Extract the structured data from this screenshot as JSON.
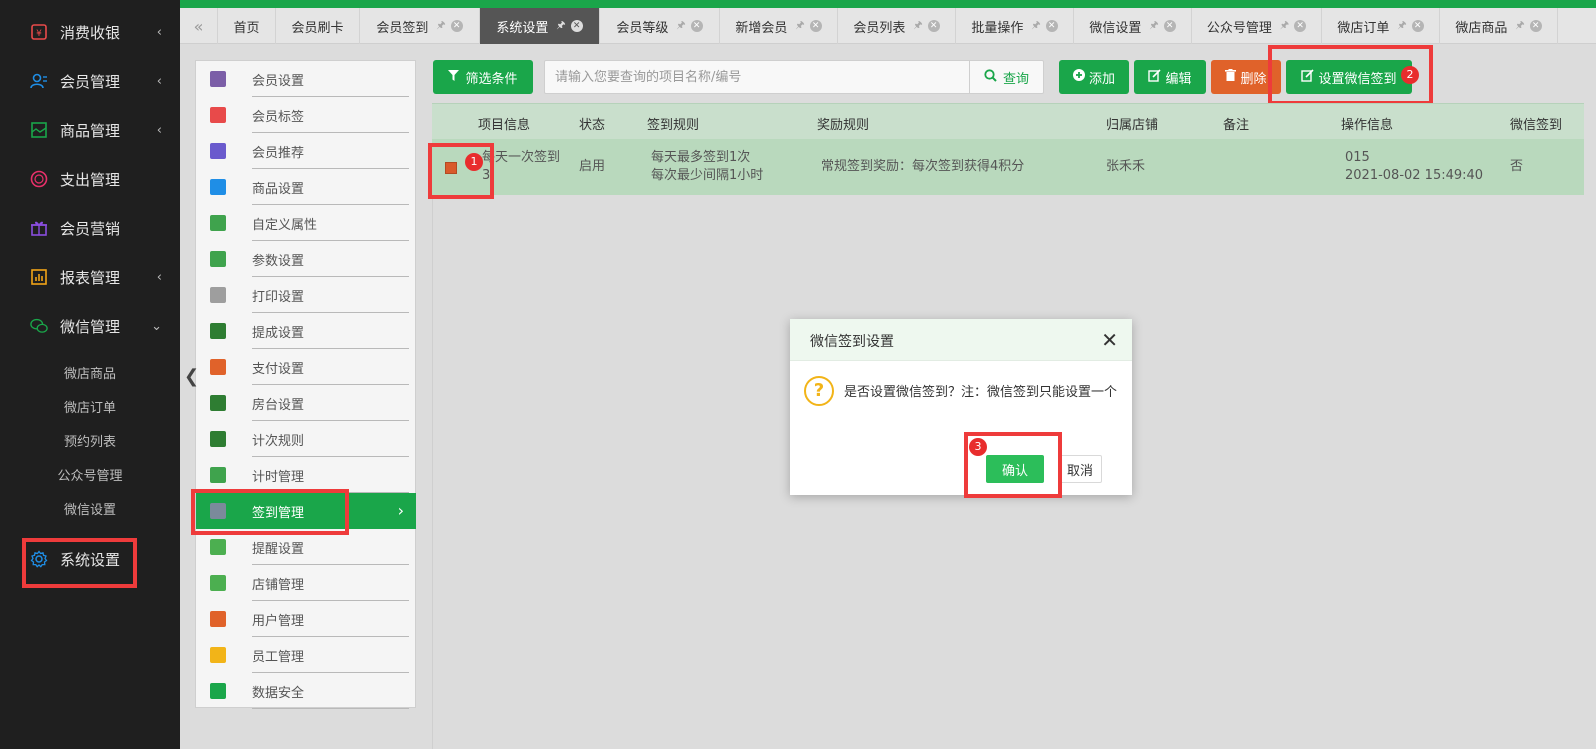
{
  "sidebar": {
    "main_items": [
      {
        "label": "消费收银",
        "icon": "cashier-icon",
        "color": "#e84a4a"
      },
      {
        "label": "会员管理",
        "icon": "user-icon",
        "color": "#1f8ee6"
      },
      {
        "label": "商品管理",
        "icon": "product-icon",
        "color": "#1aa64a"
      },
      {
        "label": "支出管理",
        "icon": "expense-icon",
        "color": "#e8306a"
      },
      {
        "label": "会员营销",
        "icon": "gift-icon",
        "color": "#8a4de0"
      },
      {
        "label": "报表管理",
        "icon": "chart-icon",
        "color": "#f2a417"
      },
      {
        "label": "微信管理",
        "icon": "wechat-icon",
        "color": "#1aa64a"
      }
    ],
    "sub_items": [
      "微店商品",
      "微店订单",
      "预约列表",
      "公众号管理",
      "微信设置"
    ],
    "system": {
      "label": "系统设置",
      "icon": "gear-icon",
      "color": "#1f8ee6"
    }
  },
  "tabs": [
    {
      "label": "首页",
      "pinned": false
    },
    {
      "label": "会员刷卡",
      "pinned": false
    },
    {
      "label": "会员签到",
      "pinned": true
    },
    {
      "label": "系统设置",
      "pinned": true,
      "active": true
    },
    {
      "label": "会员等级",
      "pinned": true
    },
    {
      "label": "新增会员",
      "pinned": true
    },
    {
      "label": "会员列表",
      "pinned": true
    },
    {
      "label": "批量操作",
      "pinned": true
    },
    {
      "label": "微信设置",
      "pinned": true
    },
    {
      "label": "公众号管理",
      "pinned": true
    },
    {
      "label": "微店订单",
      "pinned": true
    },
    {
      "label": "微店商品",
      "pinned": true
    }
  ],
  "settings_menu": [
    {
      "label": "会员设置",
      "icon_color": "#7b5ea7"
    },
    {
      "label": "会员标签",
      "icon_color": "#e84a4a"
    },
    {
      "label": "会员推荐",
      "icon_color": "#6a5acd"
    },
    {
      "label": "商品设置",
      "icon_color": "#1f8ee6"
    },
    {
      "label": "自定义属性",
      "icon_color": "#3fa34d"
    },
    {
      "label": "参数设置",
      "icon_color": "#3fa34d"
    },
    {
      "label": "打印设置",
      "icon_color": "#9e9e9e"
    },
    {
      "label": "提成设置",
      "icon_color": "#2e7d32"
    },
    {
      "label": "支付设置",
      "icon_color": "#e0622a"
    },
    {
      "label": "房台设置",
      "icon_color": "#2e7d32"
    },
    {
      "label": "计次规则",
      "icon_color": "#2e7d32"
    },
    {
      "label": "计时管理",
      "icon_color": "#3fa34d"
    },
    {
      "label": "签到管理",
      "icon_color": "#7b8a9b",
      "active": true
    },
    {
      "label": "提醒设置",
      "icon_color": "#4caf50"
    },
    {
      "label": "店铺管理",
      "icon_color": "#4caf50"
    },
    {
      "label": "用户管理",
      "icon_color": "#e0622a"
    },
    {
      "label": "员工管理",
      "icon_color": "#f2b418"
    },
    {
      "label": "数据安全",
      "icon_color": "#1aa64a"
    }
  ],
  "toolbar": {
    "filter_label": "筛选条件",
    "search_placeholder": "请输入您要查询的项目名称/编号",
    "search_label": "查询",
    "add_label": "添加",
    "edit_label": "编辑",
    "delete_label": "删除",
    "wechat_signin_label": "设置微信签到"
  },
  "table": {
    "headers": [
      "项目信息",
      "状态",
      "签到规则",
      "奖励规则",
      "归属店铺",
      "备注",
      "操作信息",
      "微信签到"
    ],
    "rows": [
      {
        "project": "每天一次签到",
        "project_line2": "3",
        "status": "启用",
        "rule_line1": "每天最多签到1次",
        "rule_line2": "每次最少间隔1小时",
        "reward": "常规签到奖励：每次签到获得4积分",
        "store": "张禾禾",
        "remark": "",
        "op_line1": "015",
        "op_line2": "2021-08-02 15:49:40",
        "wechat": "否"
      }
    ]
  },
  "annotations": {
    "badge1": "1",
    "badge2": "2",
    "badge3": "3"
  },
  "dialog": {
    "title": "微信签到设置",
    "message": "是否设置微信签到？注：微信签到只能设置一个",
    "confirm_label": "确认",
    "cancel_label": "取消"
  },
  "colors": {
    "accent": "#1aa64a",
    "danger": "#e0622a",
    "highlight": "#ee3b3b",
    "sidebar_bg": "#1f1f1f"
  }
}
